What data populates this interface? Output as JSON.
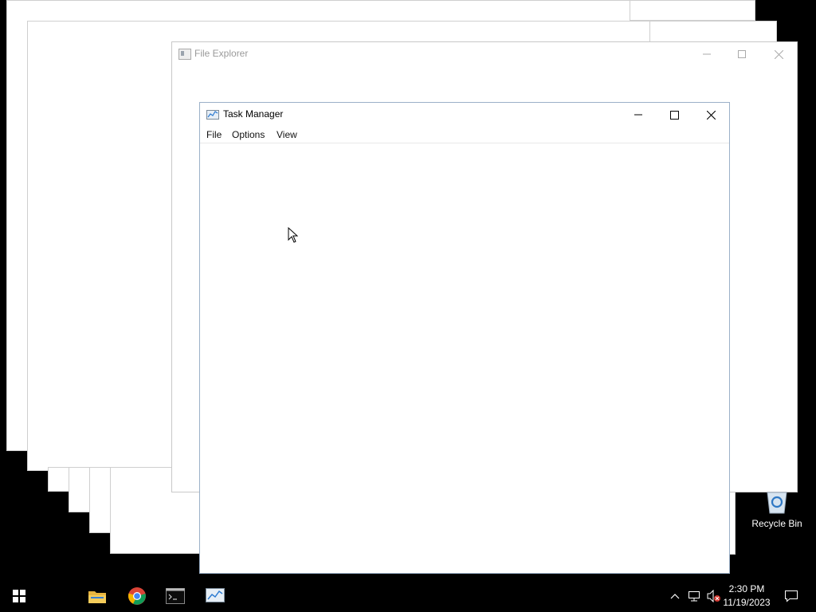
{
  "file_explorer": {
    "title": "File Explorer"
  },
  "task_manager": {
    "title": "Task Manager",
    "menu": [
      "File",
      "Options",
      "View"
    ]
  },
  "desktop": {
    "recycle_bin_label": "Recycle Bin"
  },
  "taskbar": {
    "apps": [
      "start-icon",
      "file-explorer-icon",
      "chrome-icon",
      "terminal-icon",
      "task-manager-icon"
    ],
    "tray": {
      "time": "2:30 PM",
      "date": "11/19/2023"
    }
  }
}
